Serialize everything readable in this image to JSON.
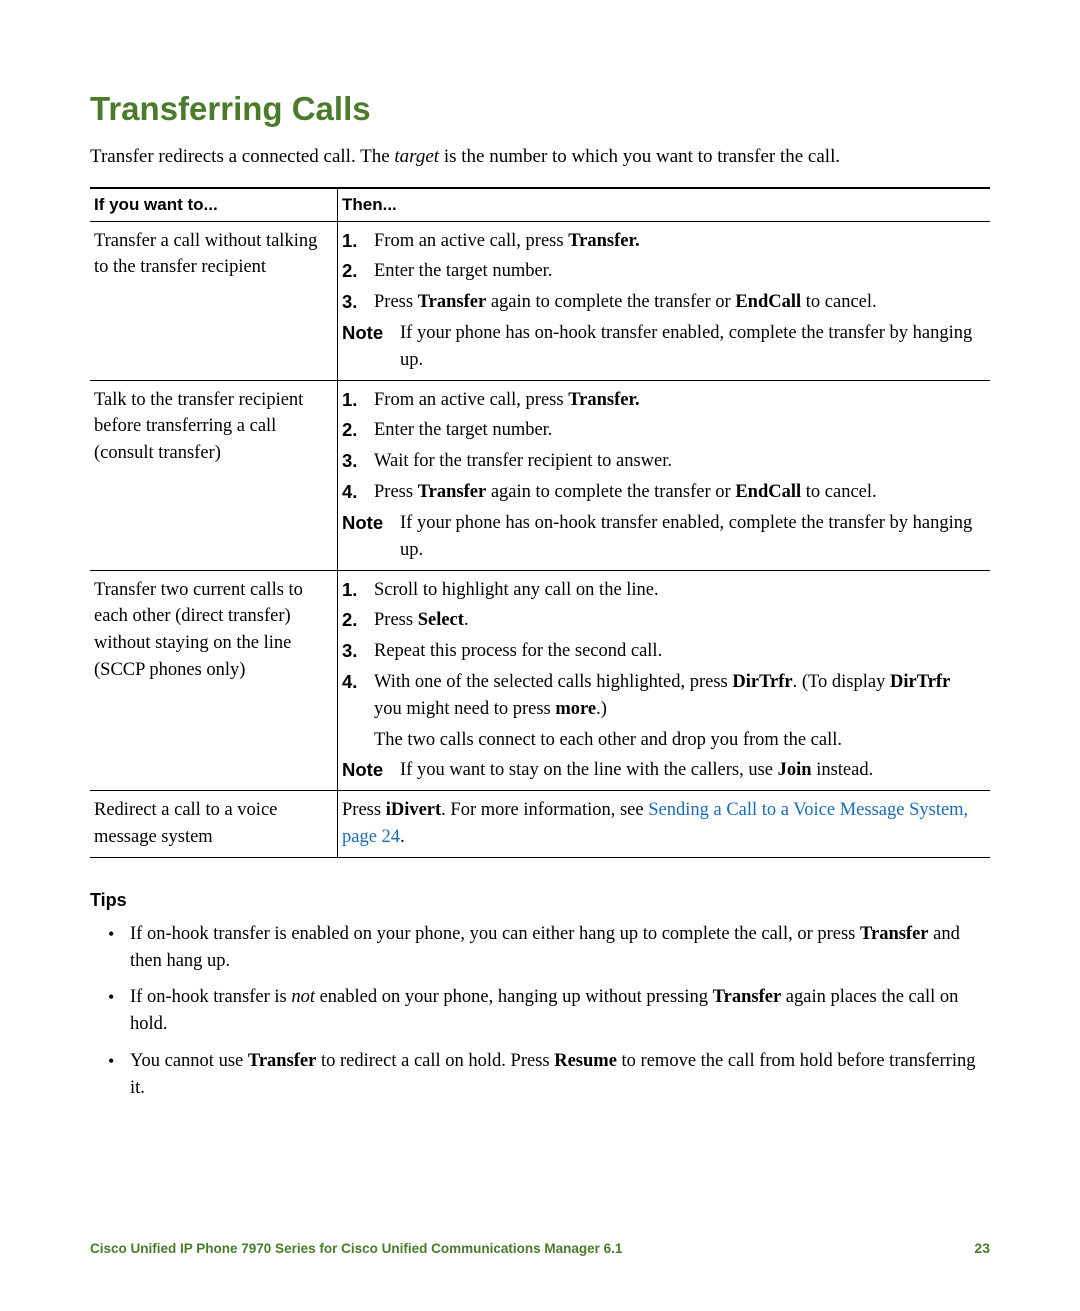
{
  "title": "Transferring Calls",
  "intro_pre": "Transfer redirects a connected call. The ",
  "intro_em": "target",
  "intro_post": " is the number to which you want to transfer the call.",
  "table": {
    "header_left": "If you want to...",
    "header_right": "Then...",
    "rows": [
      {
        "left": "Transfer a call without talking to the transfer recipient",
        "steps": [
          {
            "num": "1.",
            "pre": "From an active call, press ",
            "b1": "Transfer.",
            "post": ""
          },
          {
            "num": "2.",
            "pre": "Enter the target number.",
            "b1": "",
            "post": ""
          },
          {
            "num": "3.",
            "pre": "Press ",
            "b1": "Transfer",
            "mid": " again to complete the transfer or ",
            "b2": "EndCall",
            "post": " to cancel."
          }
        ],
        "note": "If your phone has on-hook transfer enabled, complete the transfer by hanging up."
      },
      {
        "left": "Talk to the transfer recipient before transferring a call (consult transfer)",
        "steps": [
          {
            "num": "1.",
            "pre": "From an active call, press ",
            "b1": "Transfer.",
            "post": ""
          },
          {
            "num": "2.",
            "pre": "Enter the target number.",
            "b1": "",
            "post": ""
          },
          {
            "num": "3.",
            "pre": "Wait for the transfer recipient to answer.",
            "b1": "",
            "post": ""
          },
          {
            "num": "4.",
            "pre": "Press ",
            "b1": "Transfer",
            "mid": " again to complete the transfer or ",
            "b2": "EndCall",
            "post": " to cancel."
          }
        ],
        "note": "If your phone has on-hook transfer enabled, complete the transfer by hanging up."
      },
      {
        "left": "Transfer two current calls to each other (direct transfer) without staying on the line (SCCP phones only)",
        "steps": [
          {
            "num": "1.",
            "pre": "Scroll to highlight any call on the line.",
            "b1": "",
            "post": ""
          },
          {
            "num": "2.",
            "pre": "Press ",
            "b1": "Select",
            "post": "."
          },
          {
            "num": "3.",
            "pre": "Repeat this process for the second call.",
            "b1": "",
            "post": ""
          },
          {
            "num": "4.",
            "pre": "With one of the selected calls highlighted, press ",
            "b1": "DirTrfr",
            "mid": ". (To display ",
            "b2": "DirTrfr",
            "mid2": " you might need to press ",
            "b3": "more",
            "post": ".)"
          }
        ],
        "extra": "The two calls connect to each other and drop you from the call.",
        "note_pre": "If you want to stay on the line with the callers, use ",
        "note_b": "Join",
        "note_post": " instead."
      },
      {
        "left": "Redirect a call to a voice message system",
        "plain_pre": "Press ",
        "plain_b": "iDivert",
        "plain_mid": ". For more information, see ",
        "plain_link": "Sending a Call to a Voice Message System, page 24",
        "plain_post": "."
      }
    ],
    "note_label": "Note"
  },
  "tips": {
    "heading": "Tips",
    "items": [
      {
        "pre": "If on-hook transfer is enabled on your phone, you can either hang up to complete the call, or press ",
        "b1": "Transfer",
        "post": " and then hang up."
      },
      {
        "pre": "If on-hook transfer is ",
        "em": "not",
        "mid": " enabled on your phone, hanging up without pressing ",
        "b1": "Transfer",
        "post": " again places the call on hold."
      },
      {
        "pre": "You cannot use ",
        "b1": "Transfer",
        "mid": " to redirect a call on hold. Press ",
        "b2": "Resume",
        "post": " to remove the call from hold before transferring it."
      }
    ]
  },
  "footer": {
    "left": "Cisco Unified IP Phone 7970 Series for Cisco Unified Communications Manager 6.1",
    "right": "23"
  }
}
